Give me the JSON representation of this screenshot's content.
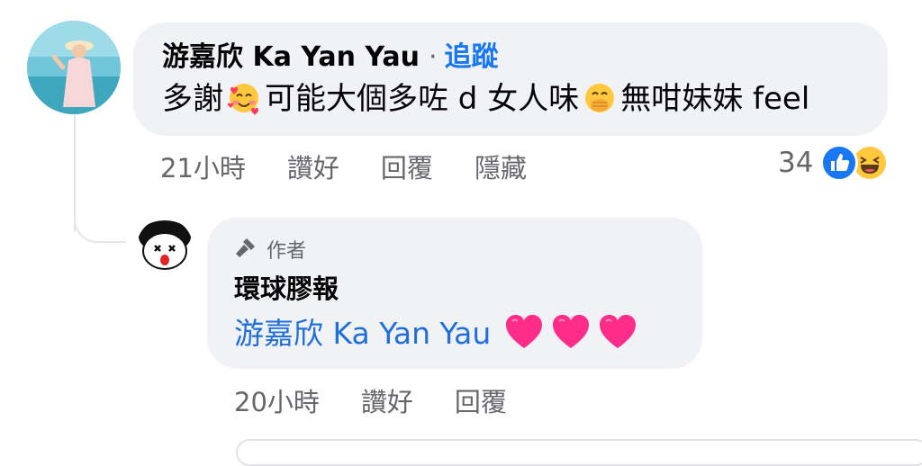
{
  "main_comment": {
    "author": "游嘉欣 Ka Yan Yau",
    "separator": "·",
    "follow_label": "追蹤",
    "text_part1": "多謝",
    "text_part2": "可能大個多咗 d 女人味",
    "text_part3": "無咁妹妹 feel",
    "emoji_1": "smiling-face-with-hearts-icon",
    "emoji_2": "hand-over-mouth-icon",
    "time": "21小時",
    "like_label": "讚好",
    "reply_label": "回覆",
    "hide_label": "隱藏",
    "reaction_count": "34"
  },
  "reply_comment": {
    "badge_label": "作者",
    "author": "環球膠報",
    "mention": "游嘉欣 Ka Yan Yau",
    "emoji": "pink-heart-icon",
    "emoji_count": 3,
    "time": "20小時",
    "like_label": "讚好",
    "reply_label": "回覆"
  },
  "colors": {
    "bubble": "#f0f2f5",
    "link_blue": "#1877f2",
    "meta_gray": "#65676b",
    "heart_pink": "#ff2d8a"
  }
}
